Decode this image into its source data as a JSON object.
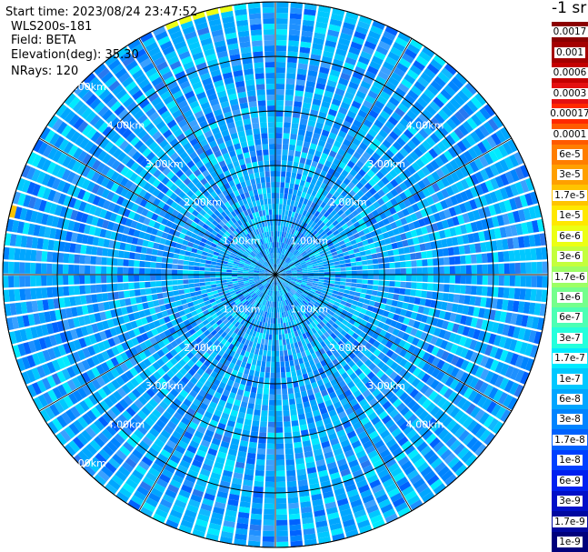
{
  "header": {
    "start_time": "Start time: 2023/08/24 23:47:52",
    "device": "WLS200s-181",
    "field": "Field: BETA",
    "elevation": "Elevation(deg): 35.30",
    "nrays": "NRays: 120",
    "unit_label": "-1 sr"
  },
  "chart_data": {
    "type": "heatmap",
    "projection": "polar-ppi",
    "field": "BETA",
    "nrays": 120,
    "max_range_km": 5.0,
    "range_rings_km": [
      1,
      2,
      3,
      4,
      5
    ],
    "range_labels": [
      "1.00km",
      "2.00km",
      "3.00km",
      "4.00km",
      "5.00km"
    ],
    "radial_spokes_deg": [
      0,
      30,
      60,
      90,
      120,
      150,
      180,
      210,
      240,
      270,
      300,
      330
    ],
    "range_gate_km": 0.1,
    "dominant_value_range": [
      "1.7e-8",
      "1e-7"
    ],
    "high_backscatter_sectors": [
      {
        "azimuth_deg": [
          335,
          352
        ],
        "range_km": [
          4.9,
          5.0
        ],
        "value": "6e-6"
      },
      {
        "azimuth_deg": [
          281,
          286
        ],
        "range_km": [
          4.88,
          5.0
        ],
        "value": "1.7e-5"
      }
    ],
    "colorbar": {
      "labels": [
        "0.0017",
        "0.001",
        "0.0006",
        "0.0003",
        "0.00017",
        "0.0001",
        "6e-5",
        "3e-5",
        "1.7e-5",
        "1e-5",
        "6e-6",
        "3e-6",
        "1.7e-6",
        "1e-6",
        "6e-7",
        "3e-7",
        "1.7e-7",
        "1e-7",
        "6e-8",
        "3e-8",
        "1.7e-8",
        "1e-8",
        "6e-9",
        "3e-9",
        "1.7e-9",
        "1e-9"
      ],
      "colors": [
        "#8b0000",
        "#a40000",
        "#c40000",
        "#e41010",
        "#ff2800",
        "#ff5a00",
        "#ff7e00",
        "#ffa000",
        "#ffc400",
        "#ffe800",
        "#ecff14",
        "#c4ff3c",
        "#9cff64",
        "#74ff8c",
        "#4cffb4",
        "#24ffdc",
        "#00eaff",
        "#00c8ff",
        "#00a6ff",
        "#0084ff",
        "#0062ff",
        "#0040ff",
        "#0020f0",
        "#0010c8",
        "#0008a0",
        "#00007c"
      ]
    }
  }
}
